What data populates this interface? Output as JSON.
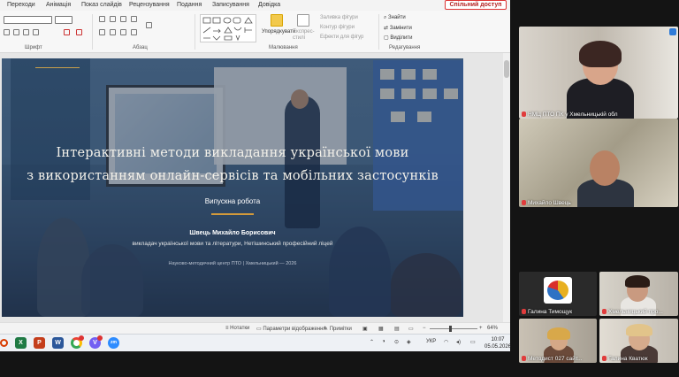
{
  "ppt": {
    "menu": [
      "Переходи",
      "Анімація",
      "Показ слайдів",
      "Рецензування",
      "Подання",
      "Записування",
      "Довідка"
    ],
    "share_label": "Спільний доступ",
    "ribbon": {
      "font_group": "Шрифт",
      "paragraph_group": "Абзац",
      "drawing_group": "Малювання",
      "editing_group": "Редагування",
      "arrange_label": "Упорядкувати",
      "quick_styles_label": "Експрес-стилі",
      "shape_fill": "Заливка фігури",
      "shape_outline": "Контур фігури",
      "shape_effects": "Ефекти для фігур",
      "find": "Знайти",
      "replace": "Замінити",
      "select": "Виділити"
    },
    "slide": {
      "title_line1": "Інтерактивні методи викладання української мови",
      "title_line2": "з використанням онлайн-сервісів та мобільних застосунків",
      "subtitle": "Випускна робота",
      "author": "Швець Михайло Борисович",
      "position": "викладач української мови та літератури, Нетішинський професійний ліцей",
      "footer": "Науково-методичний центр ПТО | Хмельницький — 2026"
    },
    "status": {
      "notes": "Нотатки",
      "display_settings": "Параметри відображення",
      "comments": "Примітки",
      "zoom": "64%"
    }
  },
  "taskbar": {
    "lang": "УКР",
    "time": "10:07",
    "date": "05.05.2026",
    "apps": [
      "Excel",
      "PowerPoint",
      "Word",
      "Chrome",
      "Viber",
      "Zoom"
    ]
  },
  "participants": [
    {
      "name": "НМЦ ПТО ПК у Хмельницькій обл"
    },
    {
      "name": "Михайло Швець"
    },
    {
      "name": "Галина Тимощук"
    },
    {
      "name": "Хмельницький про..."
    },
    {
      "name": "Методист 027 сайт..."
    },
    {
      "name": "Галина Кватюк"
    }
  ]
}
